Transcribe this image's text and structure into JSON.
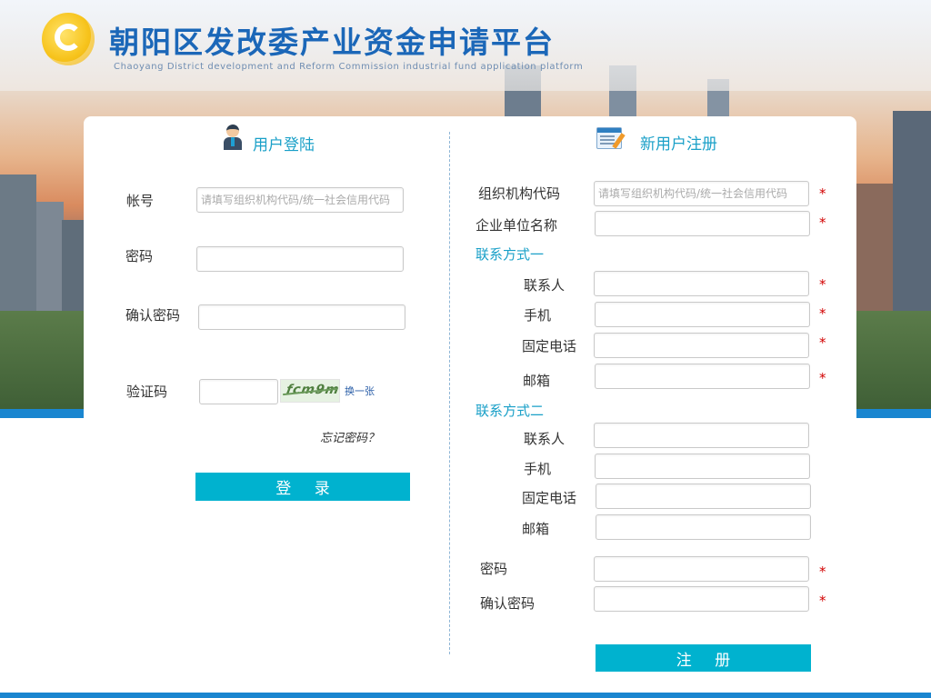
{
  "header": {
    "title": "朝阳区发改委产业资金申请平台",
    "subtitle": "Chaoyang District development and Reform Commission industrial fund application platform"
  },
  "login": {
    "heading": "用户登陆",
    "account_label": "帐号",
    "account_placeholder": "请填写组织机构代码/统一社会信用代码",
    "password_label": "密码",
    "confirm_label": "确认密码",
    "captcha_label": "验证码",
    "captcha_text": "fcm9m",
    "captcha_refresh": "换一张",
    "forgot": "忘记密码？",
    "submit": "登 录"
  },
  "register": {
    "heading": "新用户注册",
    "org_code_label": "组织机构代码",
    "org_code_placeholder": "请填写组织机构代码/统一社会信用代码",
    "company_label": "企业单位名称",
    "contact1_heading": "联系方式一",
    "contact2_heading": "联系方式二",
    "contact_person_label": "联系人",
    "mobile_label": "手机",
    "phone_label": "固定电话",
    "email_label": "邮箱",
    "password_label": "密码",
    "confirm_label": "确认密码",
    "required_mark": "*",
    "submit": "注 册"
  },
  "colors": {
    "accent": "#00b2cf",
    "title_blue": "#1b67b8",
    "required": "#d20000",
    "band": "#1a86d0"
  }
}
